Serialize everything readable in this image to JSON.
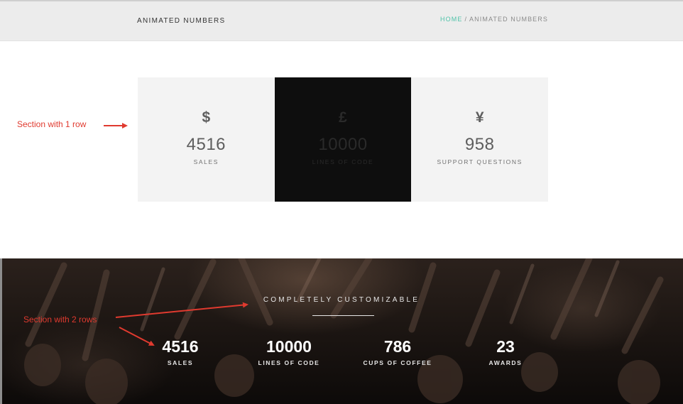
{
  "header": {
    "title": "ANIMATED NUMBERS",
    "breadcrumb": {
      "home": "HOME",
      "separator": "/",
      "current": "ANIMATED NUMBERS"
    }
  },
  "one_row_section": {
    "counters": [
      {
        "icon": "dollar-icon",
        "symbol": "$",
        "value": "4516",
        "label": "SALES",
        "theme": "light"
      },
      {
        "icon": "pound-icon",
        "symbol": "£",
        "value": "10000",
        "label": "LINES OF CODE",
        "theme": "dark"
      },
      {
        "icon": "yen-icon",
        "symbol": "¥",
        "value": "958",
        "label": "SUPPORT QUESTIONS",
        "theme": "light"
      }
    ]
  },
  "annotations": {
    "one_row": "Section with 1 row",
    "two_rows": "Section with 2 rows"
  },
  "two_row_section": {
    "heading": "COMPLETELY CUSTOMIZABLE",
    "stats": [
      {
        "value": "4516",
        "label": "SALES"
      },
      {
        "value": "10000",
        "label": "LINES OF CODE"
      },
      {
        "value": "786",
        "label": "CUPS OF COFFEE"
      },
      {
        "value": "23",
        "label": "AWARDS"
      }
    ]
  },
  "colors": {
    "accent": "#4fc3a9",
    "annotation": "#e03a2f",
    "light_cell": "#f3f3f3",
    "dark_cell": "#0e0e0e"
  }
}
